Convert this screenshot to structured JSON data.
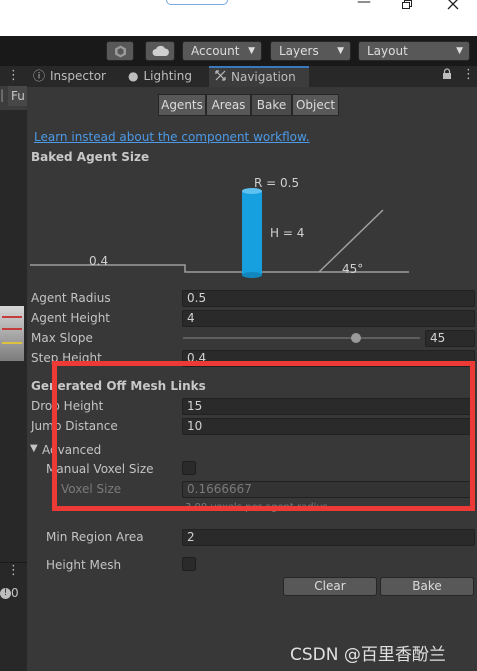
{
  "toolbar": {
    "account_label": "Account",
    "layers_label": "Layers",
    "layout_label": "Layout"
  },
  "left_panel": {
    "tab_label": "Fu",
    "badge_count": "0"
  },
  "tabs": {
    "inspector": "Inspector",
    "lighting": "Lighting",
    "navigation": "Navigation"
  },
  "nav_tabs": [
    "Agents",
    "Areas",
    "Bake",
    "Object"
  ],
  "active_nav_tab": "Bake",
  "link_text": "Learn instead about the component workflow.",
  "baked_agent_size": {
    "heading": "Baked Agent Size",
    "radius_label": "R = 0.5",
    "height_label": "H = 4",
    "step_label": "0.4",
    "slope_label": "45°"
  },
  "fields": {
    "agent_radius": {
      "label": "Agent Radius",
      "value": "0.5"
    },
    "agent_height": {
      "label": "Agent Height",
      "value": "4"
    },
    "max_slope": {
      "label": "Max Slope",
      "value": "45",
      "fraction": 0.73
    },
    "step_height": {
      "label": "Step Height",
      "value": "0.4"
    }
  },
  "off_mesh": {
    "heading": "Generated Off Mesh Links",
    "drop_height": {
      "label": "Drop Height",
      "value": "15"
    },
    "jump_distance": {
      "label": "Jump Distance",
      "value": "10"
    }
  },
  "advanced": {
    "heading": "Advanced",
    "manual_voxel_size": {
      "label": "Manual Voxel Size",
      "checked": false
    },
    "voxel_size": {
      "label": "Voxel Size",
      "value": "0.1666667"
    },
    "voxel_hint": "3.00 voxels per agent radius",
    "min_region_area": {
      "label": "Min Region Area",
      "value": "2"
    },
    "height_mesh": {
      "label": "Height Mesh",
      "checked": false
    }
  },
  "buttons": {
    "clear": "Clear",
    "bake": "Bake"
  },
  "watermark": "CSDN @百里香酚兰",
  "colors": {
    "accent": "#3a79bb",
    "link": "#4c9ae8",
    "agent_cylinder": "#17a0e0",
    "highlight": "#ec3b37"
  }
}
